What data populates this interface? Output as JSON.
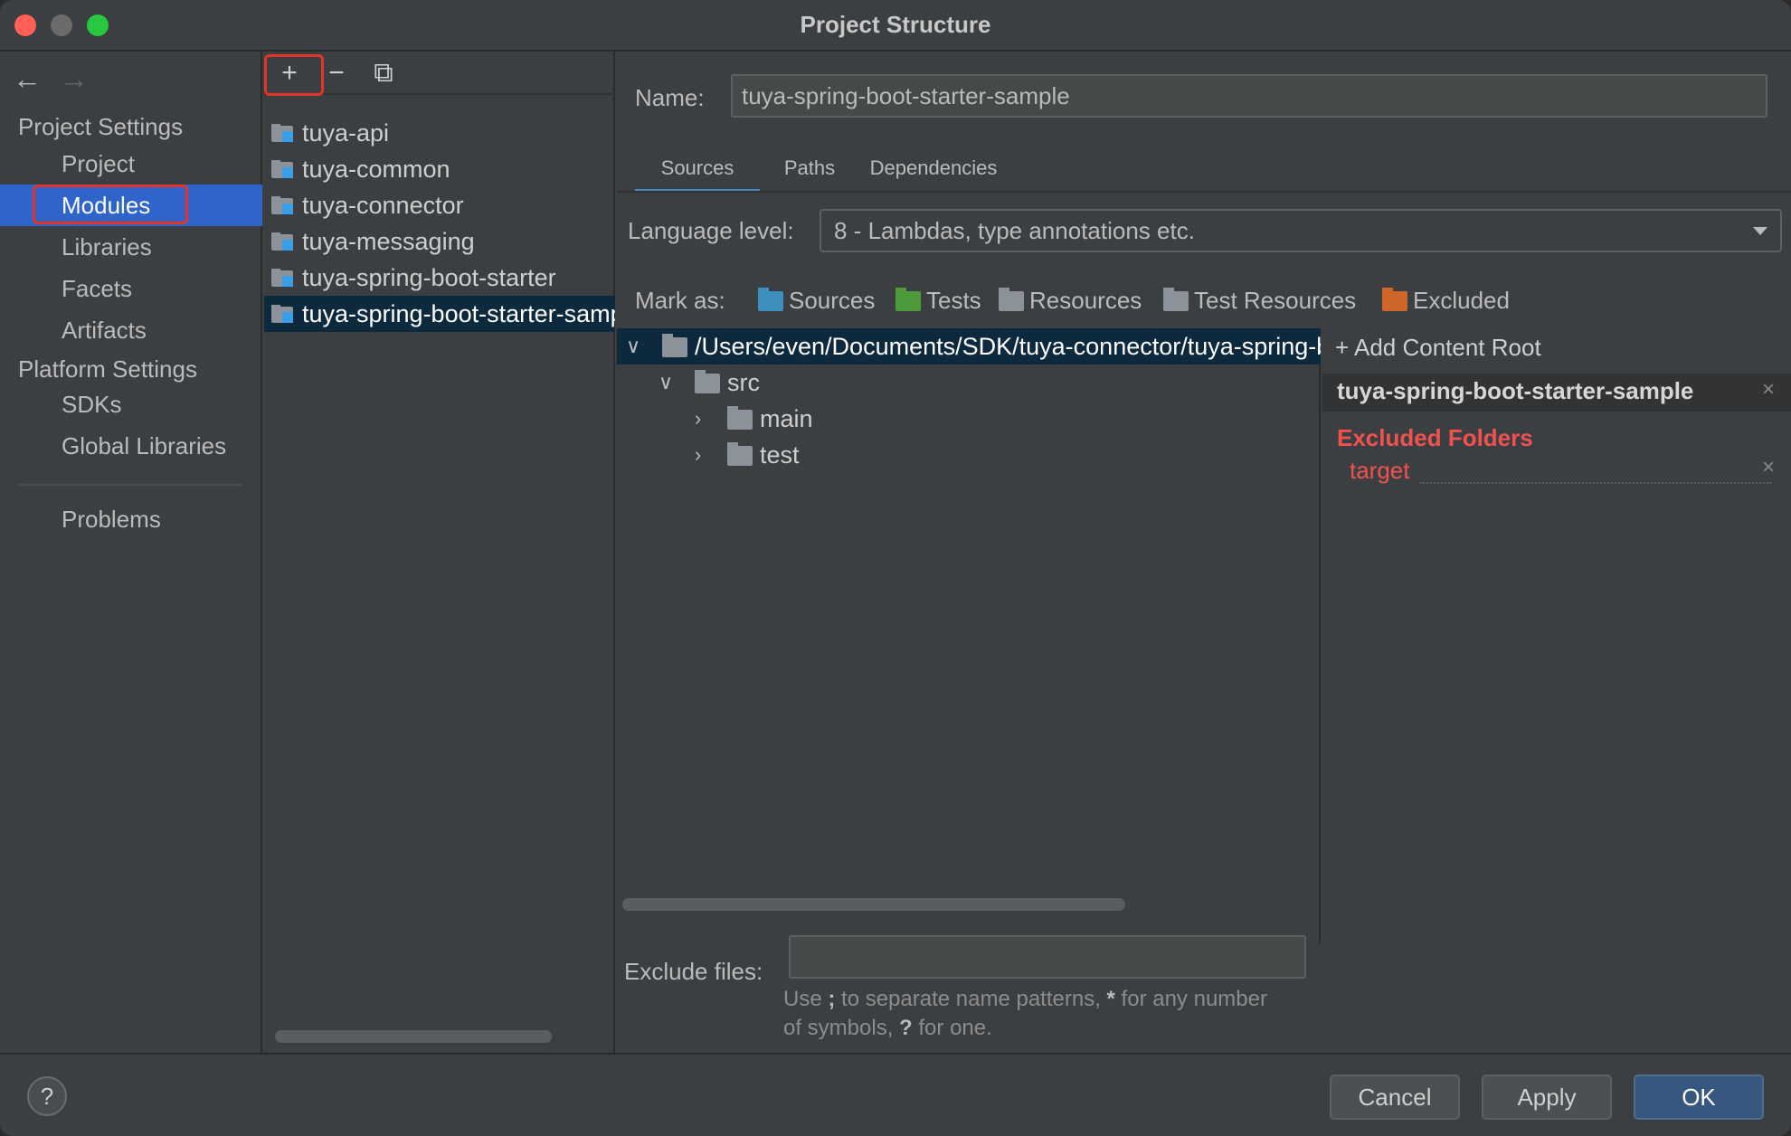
{
  "window": {
    "title": "Project Structure"
  },
  "nav": {
    "back_icon": "←",
    "forward_icon": "→",
    "project_settings": "Project Settings",
    "project_items": [
      "Project",
      "Modules",
      "Libraries",
      "Facets",
      "Artifacts"
    ],
    "platform_settings": "Platform Settings",
    "platform_items": [
      "SDKs",
      "Global Libraries"
    ],
    "problems": "Problems",
    "selected": "Modules"
  },
  "modules_toolbar": {
    "add_icon": "+",
    "remove_icon": "−",
    "copy_icon": "⧉"
  },
  "modules": [
    "tuya-api",
    "tuya-common",
    "tuya-connector",
    "tuya-messaging",
    "tuya-spring-boot-starter",
    "tuya-spring-boot-starter-sample"
  ],
  "module_detail": {
    "name_label": "Name:",
    "name_value": "tuya-spring-boot-starter-sample",
    "tabs": [
      "Sources",
      "Paths",
      "Dependencies"
    ],
    "active_tab": "Sources",
    "language_label": "Language level:",
    "language_value": "8 - Lambdas, type annotations etc.",
    "mark_as_label": "Mark as:",
    "mark_as": [
      {
        "label": "Sources",
        "color": "#3d8fbd"
      },
      {
        "label": "Tests",
        "color": "#4c9a3a"
      },
      {
        "label": "Resources",
        "color": "#8b9299"
      },
      {
        "label": "Test Resources",
        "color": "#8b9299"
      },
      {
        "label": "Excluded",
        "color": "#d0662b"
      }
    ],
    "tree": [
      {
        "label": "/Users/even/Documents/SDK/tuya-connector/tuya-spring-boot-starter-sample",
        "chevron": "∨"
      },
      {
        "label": "src",
        "chevron": "∨"
      },
      {
        "label": "main",
        "chevron": "›"
      },
      {
        "label": "test",
        "chevron": "›"
      }
    ],
    "exclude_label": "Exclude files:",
    "exclude_value": "",
    "hint_parts": [
      "Use ",
      ";",
      " to separate name patterns, ",
      "*",
      " for any number of symbols, ",
      "?",
      " for one."
    ]
  },
  "content_root": {
    "add_label": "+ Add Content Root",
    "root_name": "tuya-spring-boot-starter-sample",
    "excluded_heading": "Excluded Folders",
    "excluded_items": [
      "target"
    ],
    "remove_icon": "×",
    "excluded_color": "#f0524f"
  },
  "footer": {
    "help": "?",
    "cancel": "Cancel",
    "apply": "Apply",
    "ok": "OK"
  }
}
